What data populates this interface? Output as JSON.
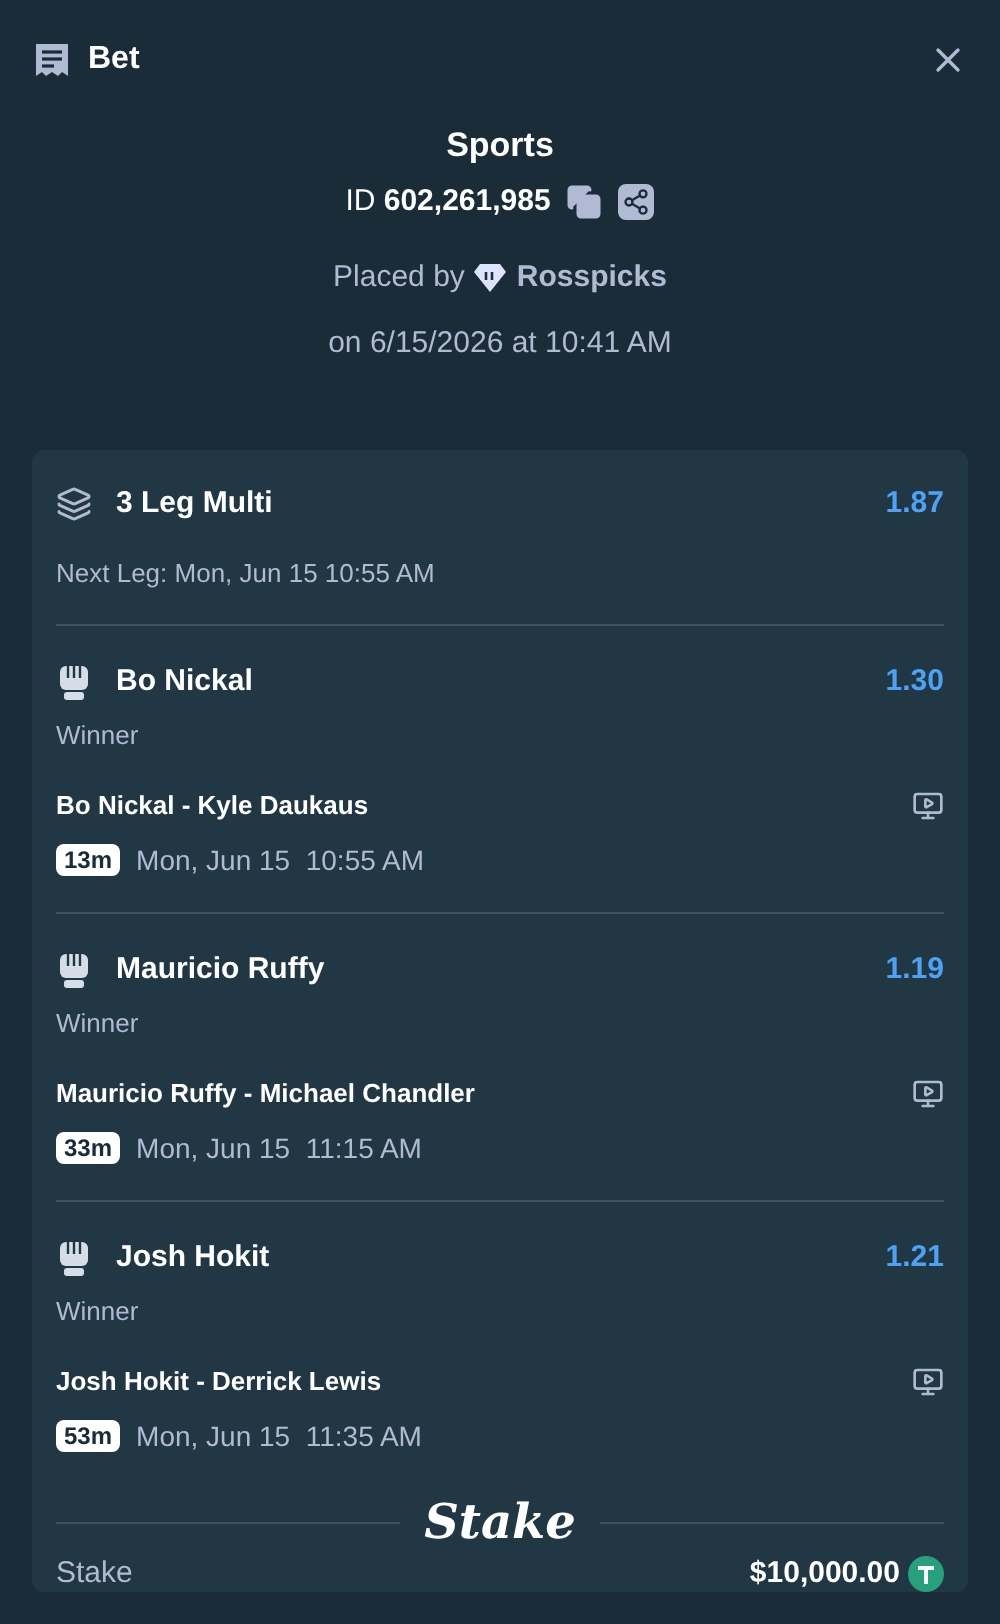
{
  "header": {
    "title": "Bet"
  },
  "summary": {
    "category": "Sports",
    "id_label": "ID",
    "id_value": "602,261,985",
    "placed_by": "Placed by",
    "user": "Rosspicks",
    "date": "on 6/15/2026 at 10:41 AM"
  },
  "multi": {
    "title": "3 Leg Multi",
    "odds": "1.87",
    "next_leg": "Next Leg: Mon, Jun 15 10:55 AM"
  },
  "legs": [
    {
      "name": "Bo Nickal",
      "odds": "1.30",
      "market": "Winner",
      "event": "Bo Nickal - Kyle Daukaus",
      "badge": "13m",
      "date": "Mon, Jun 15",
      "time": "10:55 AM"
    },
    {
      "name": "Mauricio Ruffy",
      "odds": "1.19",
      "market": "Winner",
      "event": "Mauricio Ruffy - Michael Chandler",
      "badge": "33m",
      "date": "Mon, Jun 15",
      "time": "11:15 AM"
    },
    {
      "name": "Josh Hokit",
      "odds": "1.21",
      "market": "Winner",
      "event": "Josh Hokit - Derrick Lewis",
      "badge": "53m",
      "date": "Mon, Jun 15",
      "time": "11:35 AM"
    }
  ],
  "brand": "Stake",
  "totals": [
    {
      "label": "Stake",
      "value": "$10,000.00"
    }
  ]
}
